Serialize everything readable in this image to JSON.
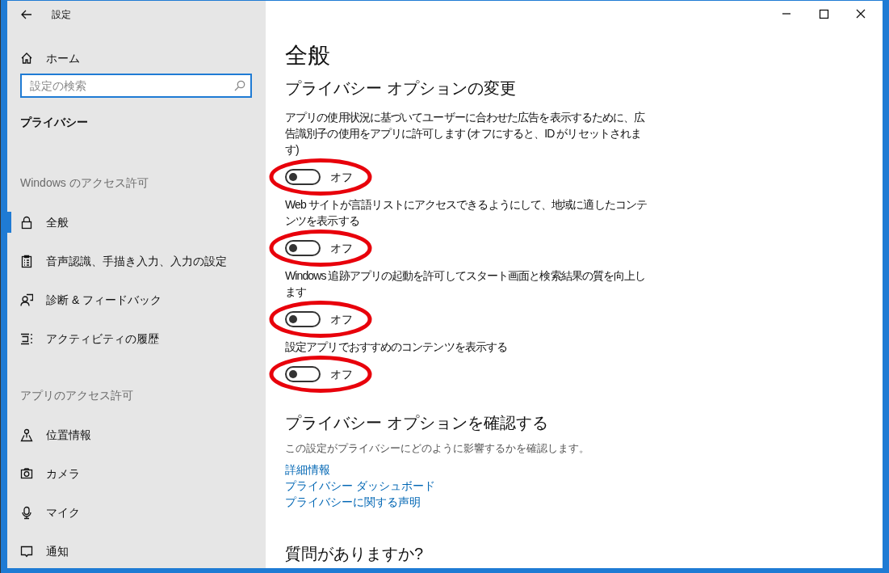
{
  "window": {
    "title": "設定"
  },
  "sidebar": {
    "home": "ホーム",
    "search": {
      "placeholder": "設定の検索"
    },
    "section_title": "プライバシー",
    "groups": [
      {
        "heading": "Windows のアクセス許可",
        "items": [
          {
            "label": "全般",
            "selected": true
          },
          {
            "label": "音声認識、手描き入力、入力の設定",
            "selected": false
          },
          {
            "label": "診断 & フィードバック",
            "selected": false
          },
          {
            "label": "アクティビティの履歴",
            "selected": false
          }
        ]
      },
      {
        "heading": "アプリのアクセス許可",
        "items": [
          {
            "label": "位置情報",
            "selected": false
          },
          {
            "label": "カメラ",
            "selected": false
          },
          {
            "label": "マイク",
            "selected": false
          },
          {
            "label": "通知",
            "selected": false
          }
        ]
      }
    ]
  },
  "content": {
    "title": "全般",
    "options": {
      "heading": "プライバシー オプションの変更",
      "settings": [
        {
          "label": "アプリの使用状況に基づいてユーザーに合わせた広告を表示するために、広告識別子の使用をアプリに許可します (オフにすると、ID がリセットされます)",
          "on": false,
          "state_label": "オフ",
          "circled": true
        },
        {
          "label": "Web サイトが言語リストにアクセスできるようにして、地域に適したコンテンツを表示する",
          "on": false,
          "state_label": "オフ",
          "circled": true
        },
        {
          "label": "Windows 追跡アプリの起動を許可してスタート画面と検索結果の質を向上します",
          "on": false,
          "state_label": "オフ",
          "circled": true
        },
        {
          "label": "設定アプリでおすすめのコンテンツを表示する",
          "on": false,
          "state_label": "オフ",
          "circled": true
        }
      ]
    },
    "review": {
      "heading": "プライバシー オプションを確認する",
      "description": "この設定がプライバシーにどのように影響するかを確認します。",
      "links": [
        "詳細情報",
        "プライバシー ダッシュボード",
        "プライバシーに関する声明"
      ]
    },
    "questions": {
      "heading": "質問がありますか?"
    }
  }
}
